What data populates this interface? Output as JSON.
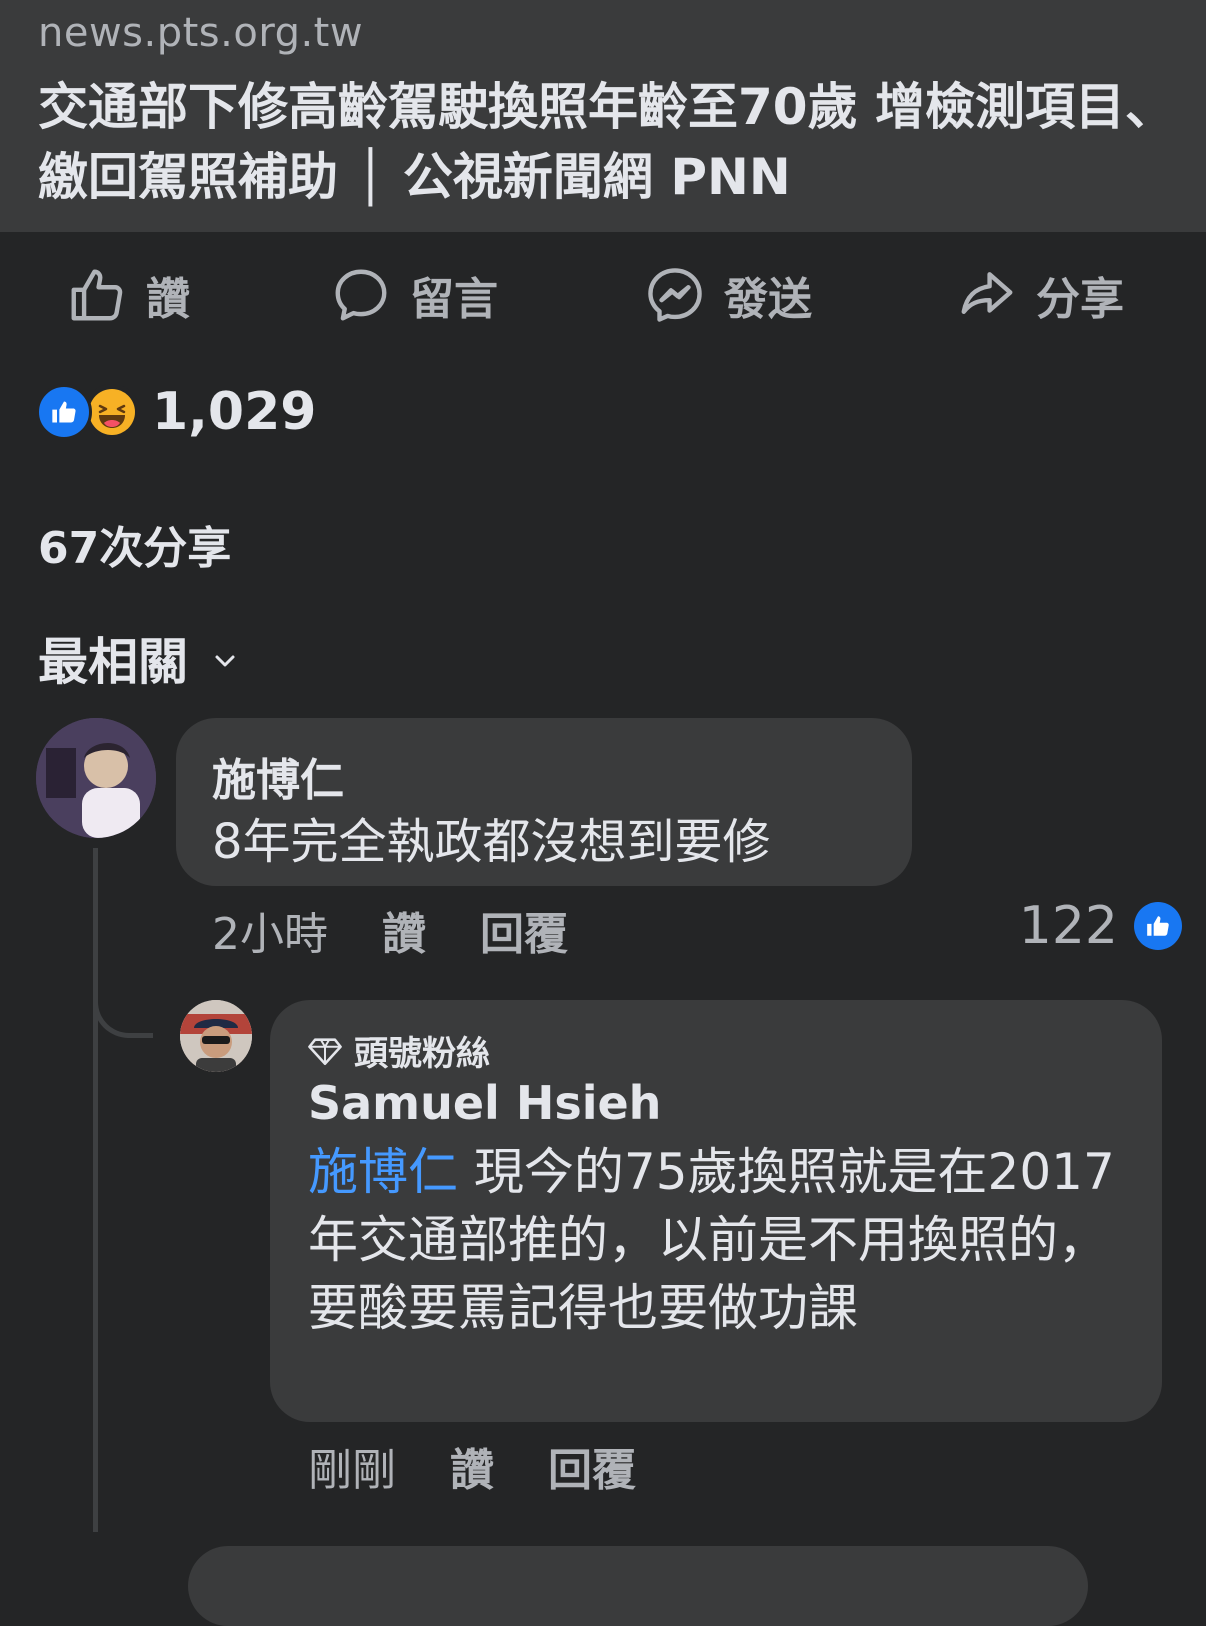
{
  "link_preview": {
    "domain": "news.pts.org.tw",
    "title": "交通部下修高齡駕駛換照年齡至70歲 增檢測項目、繳回駕照補助 │ 公視新聞網 PNN"
  },
  "actions": {
    "like": "讚",
    "comment": "留言",
    "send": "發送",
    "share": "分享"
  },
  "reactions": {
    "count": "1,029",
    "types": [
      "like",
      "haha"
    ]
  },
  "shares": "67次分享",
  "sort": {
    "label": "最相關"
  },
  "comments": [
    {
      "author": "施博仁",
      "text": "8年完全執政都沒想到要修",
      "time": "2小時",
      "like_label": "讚",
      "reply_label": "回覆",
      "like_count": "122",
      "replies": [
        {
          "badge": "頭號粉絲",
          "author": "Samuel Hsieh",
          "mention": "施博仁",
          "text": " 現今的75歲換照就是在2017年交通部推的，以前是不用換照的，要酸要罵記得也要做功課",
          "time": "剛剛",
          "like_label": "讚",
          "reply_label": "回覆"
        }
      ]
    }
  ],
  "colors": {
    "background": "#242526",
    "card": "#3a3b3c",
    "primary_text": "#e4e6eb",
    "secondary_text": "#b0b3b8",
    "accent_blue": "#1877f2",
    "mention_blue": "#4599ff"
  }
}
